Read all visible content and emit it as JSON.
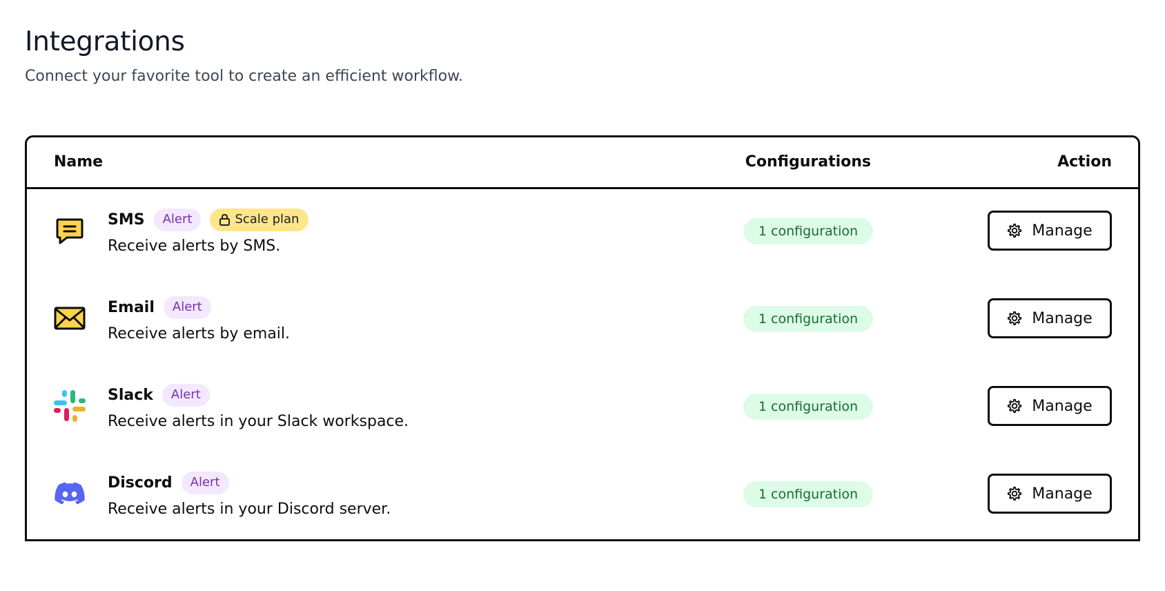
{
  "page": {
    "title": "Integrations",
    "subtitle": "Connect your favorite tool to create an efficient workflow."
  },
  "table": {
    "headers": {
      "name": "Name",
      "configurations": "Configurations",
      "action": "Action"
    },
    "rows": [
      {
        "icon": "sms-chat-icon",
        "name": "SMS",
        "badge": "Alert",
        "plan_badge": "Scale plan",
        "description": "Receive alerts by SMS.",
        "configurations": "1 configuration",
        "action": "Manage"
      },
      {
        "icon": "email-envelope-icon",
        "name": "Email",
        "badge": "Alert",
        "description": "Receive alerts by email.",
        "configurations": "1 configuration",
        "action": "Manage"
      },
      {
        "icon": "slack-logo-icon",
        "name": "Slack",
        "badge": "Alert",
        "description": "Receive alerts in your Slack workspace.",
        "configurations": "1 configuration",
        "action": "Manage"
      },
      {
        "icon": "discord-logo-icon",
        "name": "Discord",
        "badge": "Alert",
        "description": "Receive alerts in your Discord server.",
        "configurations": "1 configuration",
        "action": "Manage"
      }
    ]
  },
  "colors": {
    "alert_badge_bg": "#f3e8fd",
    "alert_badge_text": "#7a2fb3",
    "plan_badge_bg": "#fde68a",
    "config_badge_bg": "#dcfce7",
    "config_badge_text": "#176b34",
    "icon_yellow": "#fcd34d",
    "discord_blurple": "#5865f2"
  }
}
